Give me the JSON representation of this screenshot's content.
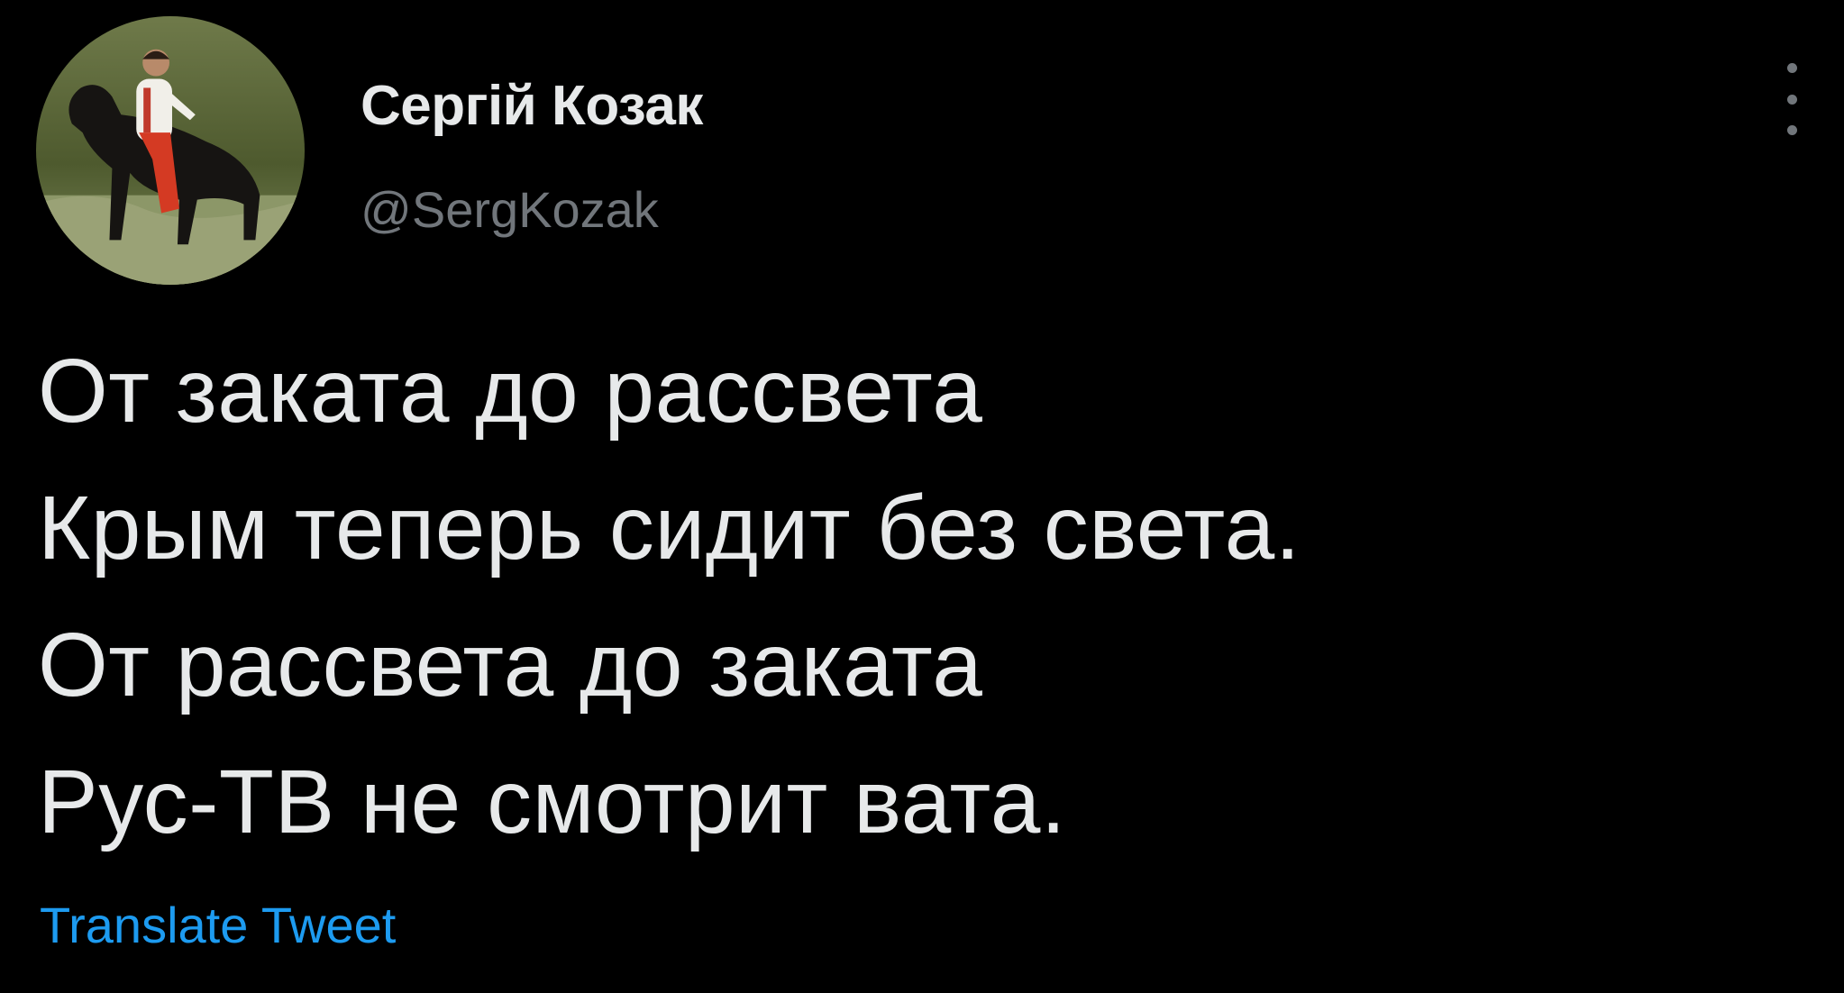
{
  "tweet": {
    "author": {
      "display_name": "Сергій Козак",
      "handle": "@SergKozak",
      "avatar_icon": "avatar-rider-on-horse"
    },
    "more_icon": "more-vertical-icon",
    "lines": [
      "От заката до рассвета",
      "Крым теперь сидит без света.",
      "От рассвета до заката",
      "Рус-ТВ не смотрит вата."
    ],
    "translate_label": "Translate Tweet"
  },
  "colors": {
    "background": "#000000",
    "primary_text": "#e7e9ea",
    "secondary_text": "#71767b",
    "link": "#1d9bf0"
  }
}
